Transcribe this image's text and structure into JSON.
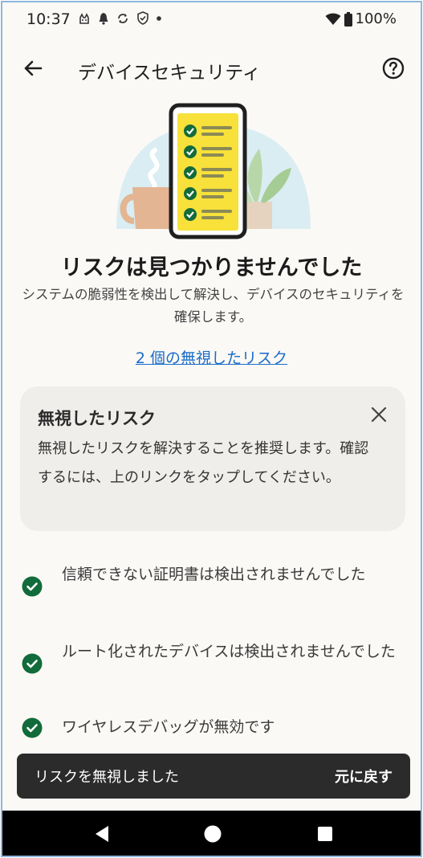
{
  "status_bar": {
    "time": "10:37",
    "battery": "100%",
    "icons": [
      "cat-icon",
      "bell-icon",
      "sync-icon",
      "shield-icon",
      "dot-icon",
      "wifi-icon",
      "battery-icon"
    ]
  },
  "app_bar": {
    "title": "デバイスセキュリティ",
    "back_icon": "arrow-left-icon",
    "help_icon": "help-circle-icon"
  },
  "main": {
    "headline": "リスクは見つかりませんでした",
    "description": "システムの脆弱性を検出して解決し、デバイスのセキュリティを確保します。",
    "ignored_link": "2 個の無視したリスク"
  },
  "card": {
    "title": "無視したリスク",
    "body": "無視したリスクを解決することを推奨します。確認するには、上のリンクをタップしてください。",
    "close_icon": "close-icon"
  },
  "checks": [
    {
      "text": "信頼できない証明書は検出されませんでした",
      "icon": "check-circle-icon"
    },
    {
      "text": "ルート化されたデバイスは検出されませんでした",
      "icon": "check-circle-icon"
    },
    {
      "text": "ワイヤレスデバッグが無効です",
      "icon": "check-circle-icon"
    }
  ],
  "snackbar": {
    "message": "リスクを無視しました",
    "action": "元に戻す"
  },
  "colors": {
    "background": "#fbf9f6",
    "card": "#f0eeeb",
    "link": "#1a6bc7",
    "check": "#126b3a",
    "snackbar": "#2b2b2b",
    "phone_screen": "#f7e13a"
  }
}
